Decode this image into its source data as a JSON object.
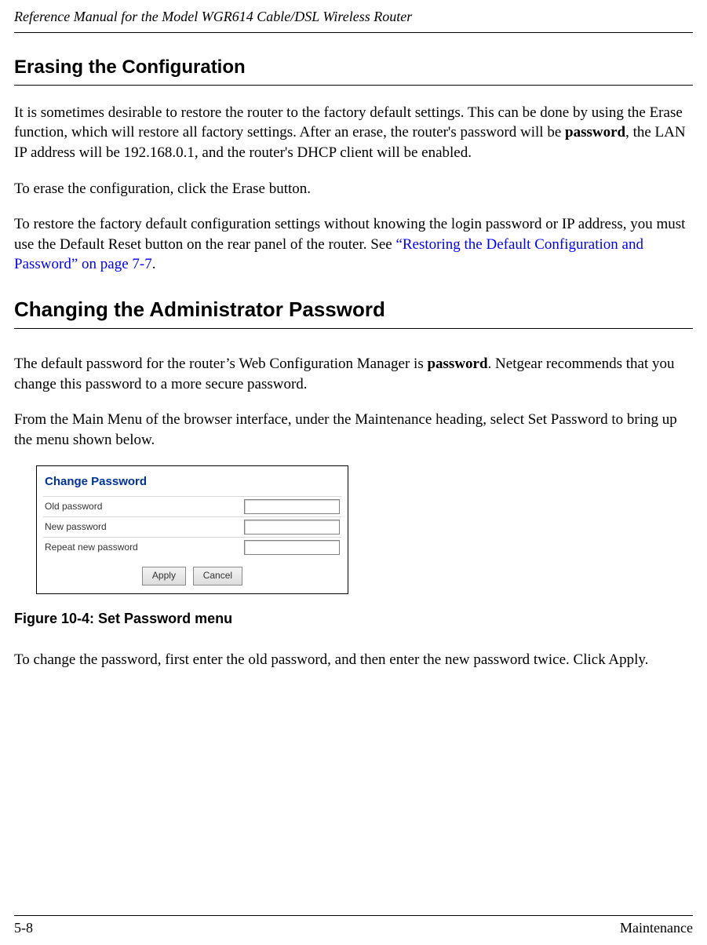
{
  "header": {
    "title": "Reference Manual for the Model WGR614 Cable/DSL Wireless Router"
  },
  "section1": {
    "heading": "Erasing the Configuration",
    "p1_a": "It is sometimes desirable to restore the router to the factory default settings. This can be done by using the Erase function, which will restore all factory settings. After an erase, the router's password will be ",
    "p1_b": "password",
    "p1_c": ", the LAN IP address will be 192.168.0.1, and the router's DHCP client will be enabled.",
    "p2": "To erase the configuration, click the Erase button.",
    "p3_a": "To restore the factory default configuration settings without knowing the login password or IP address, you must use the Default Reset button on the rear panel of the router. See ",
    "p3_link": "“Restoring the Default Configuration and Password” on page 7-7",
    "p3_c": "."
  },
  "section2": {
    "heading": "Changing the Administrator Password",
    "p1_a": "The default password for the router’s Web Configuration Manager is ",
    "p1_b": "password",
    "p1_c": ". Netgear recommends that you change this password to a more secure password.",
    "p2": "From the Main Menu of the browser interface, under the Maintenance heading, select Set Password to bring up the menu shown below."
  },
  "figure": {
    "panel_title": "Change Password",
    "rows": {
      "old": "Old password",
      "new": "New password",
      "repeat": "Repeat new password"
    },
    "btn_apply": "Apply",
    "btn_cancel": "Cancel",
    "caption": "Figure 10-4: Set Password menu"
  },
  "closing": {
    "p": "To change the password, first enter the old password, and then enter the new password twice. Click Apply."
  },
  "footer": {
    "page": "5-8",
    "section": "Maintenance"
  }
}
